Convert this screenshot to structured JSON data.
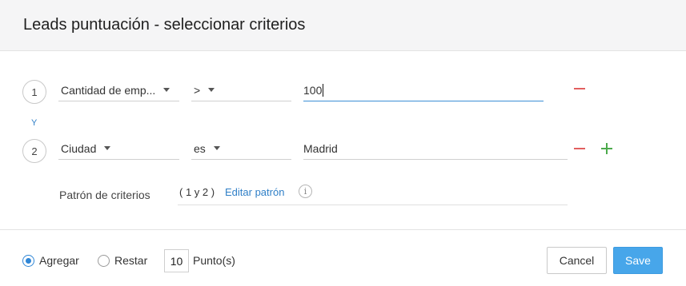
{
  "dialog": {
    "title": "Leads puntuación - seleccionar criterios"
  },
  "criteria": [
    {
      "number": "1",
      "field": "Cantidad de emp...",
      "operator": ">",
      "value": "100"
    },
    {
      "number": "2",
      "field": "Ciudad",
      "operator": "es",
      "value": "Madrid"
    }
  ],
  "connector": "Y",
  "pattern": {
    "label": "Patrón de criterios",
    "value": "( 1 y 2 )",
    "edit_link": "Editar patrón",
    "info_glyph": "i"
  },
  "footer": {
    "add_label": "Agregar",
    "subtract_label": "Restar",
    "selected_mode": "Agregar",
    "points": "10",
    "points_unit": "Punto(s)",
    "cancel_label": "Cancel",
    "save_label": "Save"
  },
  "colors": {
    "accent": "#47a6ea",
    "link": "#2f7fc7",
    "remove": "#e25f5f",
    "add": "#4caa4c"
  }
}
